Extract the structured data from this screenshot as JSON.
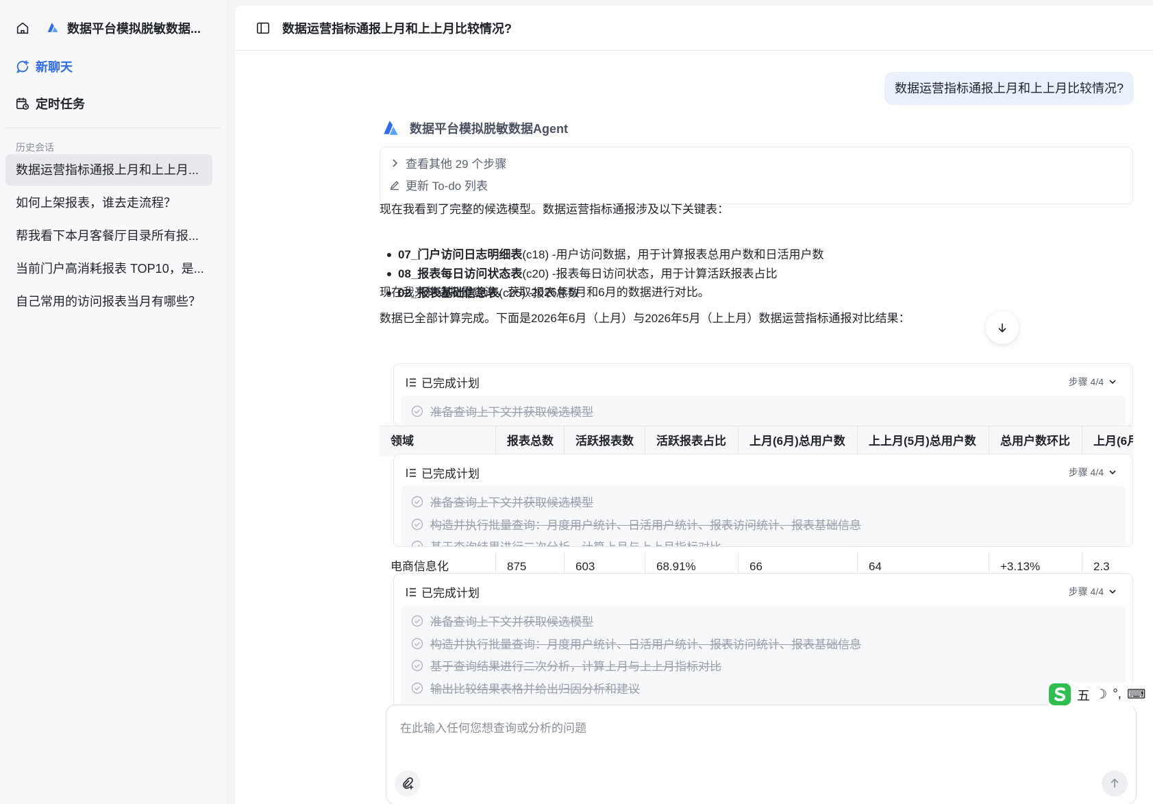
{
  "sidebar": {
    "app_title": "数据平台模拟脱敏数据...",
    "new_chat": "新聊天",
    "scheduled": "定时任务",
    "history_label": "历史会话",
    "history": [
      "数据运营指标通报上月和上上月...",
      "如何上架报表，谁去走流程？",
      "帮我看下本月客餐厅目录所有报...",
      "当前门户高消耗报表 TOP10，是...",
      "自己常用的访问报表当月有哪些？"
    ]
  },
  "main": {
    "title": "数据运营指标通报上月和上上月比较情况?",
    "user_message": "数据运营指标通报上月和上上月比较情况?",
    "agent_name": "数据平台模拟脱敏数据Agent",
    "steps": {
      "more": "查看其他 29 个步骤",
      "update": "更新 To-do 列表"
    },
    "para1": "现在我看到了完整的候选模型。数据运营指标通报涉及以下关键表：",
    "bullets": [
      {
        "name": "07_门户访问日志明细表",
        "code": " (c18) - ",
        "desc": "用户访问数据，用于计算报表总用户数和日活用户数"
      },
      {
        "name": "08_报表每日访问状态表",
        "code": " (c20) - ",
        "desc": "报表每日访问状态，用于计算活跃报表占比"
      },
      {
        "name": "02_报表基础信息表",
        "code": " (c25) - ",
        "desc": "报表总数"
      }
    ],
    "para2": "现在我来构造批量查询，获取2026年5月和6月的数据进行对比。",
    "para3": "数据已全部计算完成。下面是2026年6月（上月）与2026年5月（上上月）数据运营指标通报对比结果：",
    "plan": {
      "title": "已完成计划",
      "steps_label": "步骤 4/4",
      "items": [
        "准备查询上下文并获取候选模型",
        "构造并执行批量查询：月度用户统计、日活用户统计、报表访问统计、报表基础信息",
        "基于查询结果进行二次分析，计算上月与上上月指标对比",
        "输出比较结果表格并给出归因分析和建议"
      ]
    },
    "table": {
      "headers": [
        "领域",
        "报表总数",
        "活跃报表数",
        "活跃报表占比",
        "上月(6月)总用户数",
        "上上月(5月)总用户数",
        "总用户数环比",
        "上月(6月"
      ],
      "row": [
        "电商信息化",
        "875",
        "603",
        "68.91%",
        "66",
        "64",
        "+3.13%",
        "2.3"
      ]
    },
    "input_placeholder": "在此输入任何您想查询或分析的问题"
  },
  "ime": {
    "mode": "五",
    "moon": "☽",
    "punct": "°,",
    "keyboard": "⌨"
  },
  "colors": {
    "accent": "#2f6bf0",
    "user_bubble": "#eaf1fd"
  }
}
